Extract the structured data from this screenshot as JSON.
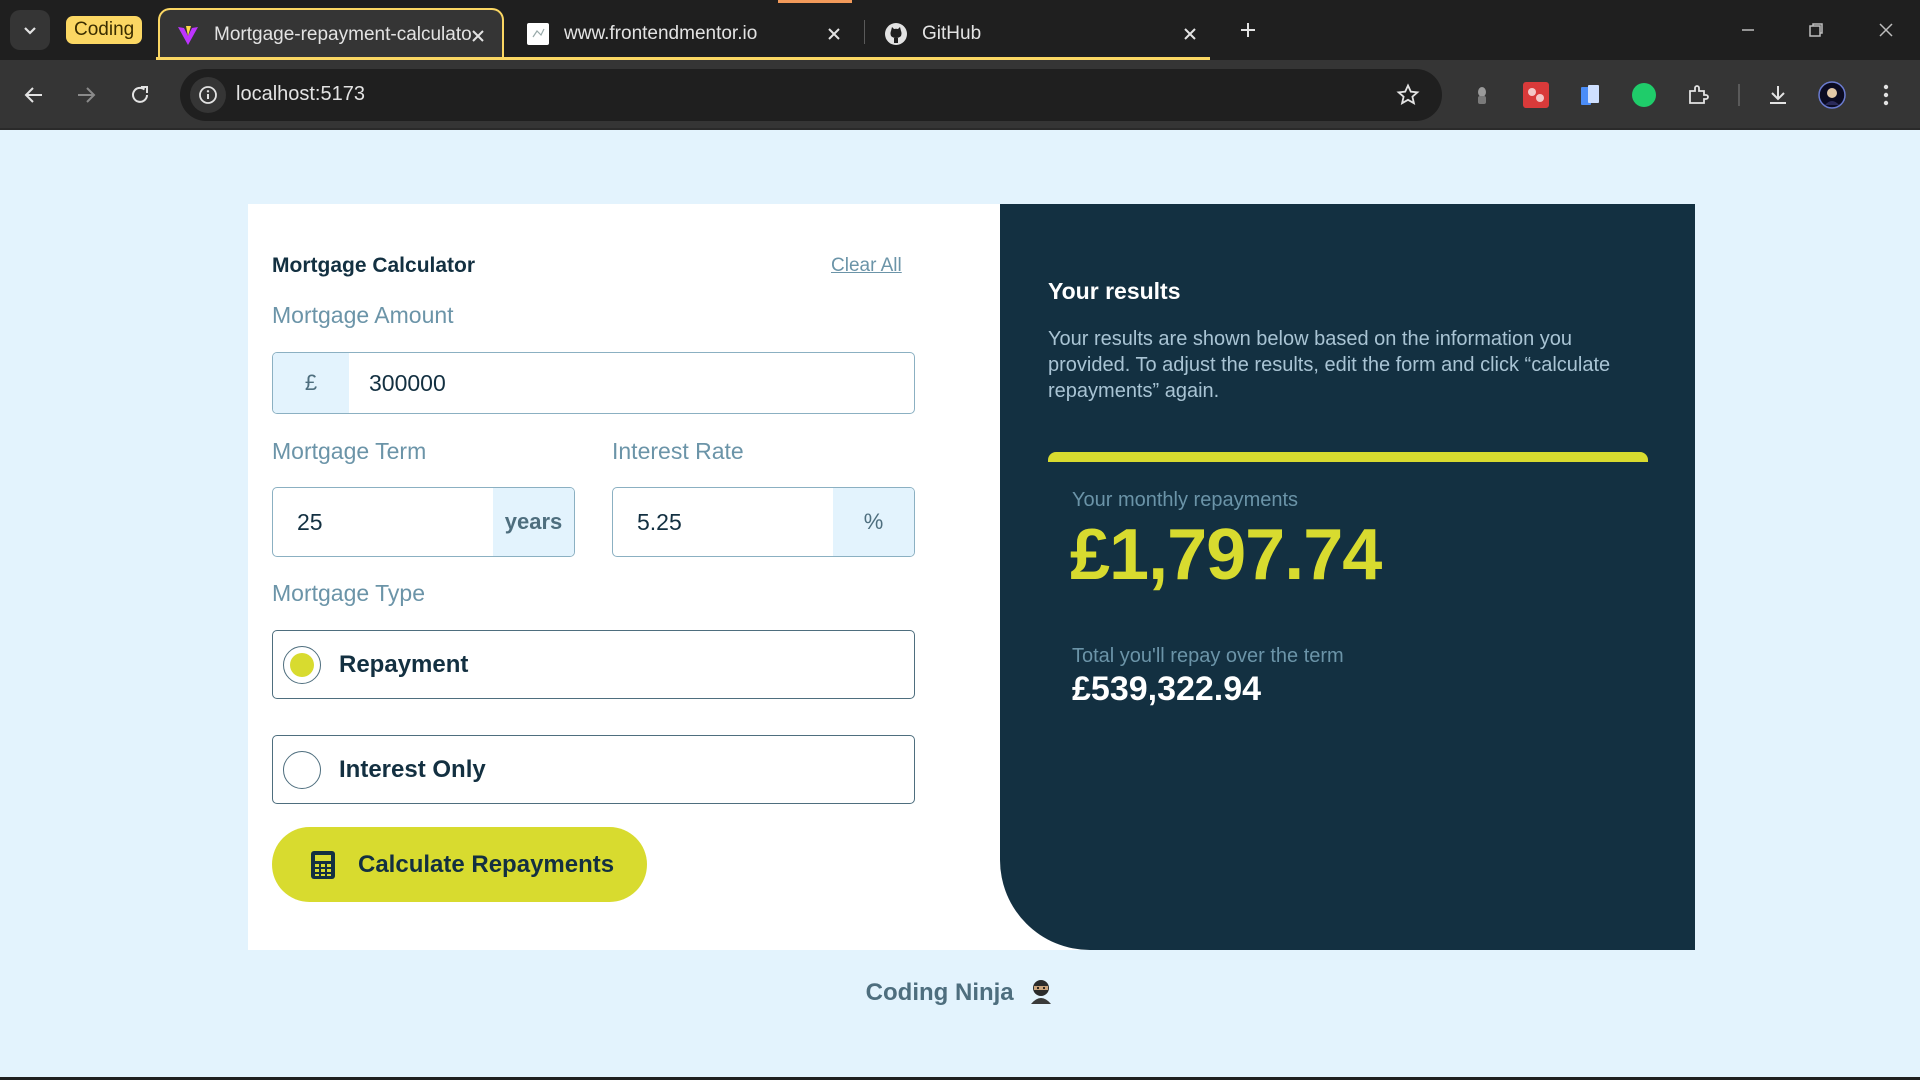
{
  "browser": {
    "tab_group_label": "Coding",
    "tabs": [
      {
        "title": "Mortgage-repayment-calculato"
      },
      {
        "title": "www.frontendmentor.io"
      },
      {
        "title": "GitHub"
      }
    ],
    "url": "localhost:5173"
  },
  "form": {
    "title": "Mortgage Calculator",
    "clear_all": "Clear All",
    "amount": {
      "label": "Mortgage Amount",
      "prefix": "£",
      "value": "300000"
    },
    "term": {
      "label": "Mortgage Term",
      "value": "25",
      "suffix": "years"
    },
    "rate": {
      "label": "Interest Rate",
      "value": "5.25",
      "suffix": "%"
    },
    "type": {
      "label": "Mortgage Type",
      "options": [
        {
          "label": "Repayment",
          "selected": true
        },
        {
          "label": "Interest Only",
          "selected": false
        }
      ]
    },
    "submit": "Calculate Repayments"
  },
  "results": {
    "title": "Your results",
    "description": "Your results are shown below based on the information you provided. To adjust the results, edit the form and click “calculate repayments” again.",
    "monthly_label": "Your monthly repayments",
    "monthly_value": "£1,797.74",
    "total_label": "Total you'll repay over the term",
    "total_value": "£539,322.94"
  },
  "footer": {
    "text": "Coding Ninja"
  },
  "colors": {
    "lime": "#d8db2f",
    "slate_900": "#133041",
    "slate_500": "#6b94a8",
    "page_bg": "#e3f3fd",
    "tab_group": "#fbd763"
  }
}
